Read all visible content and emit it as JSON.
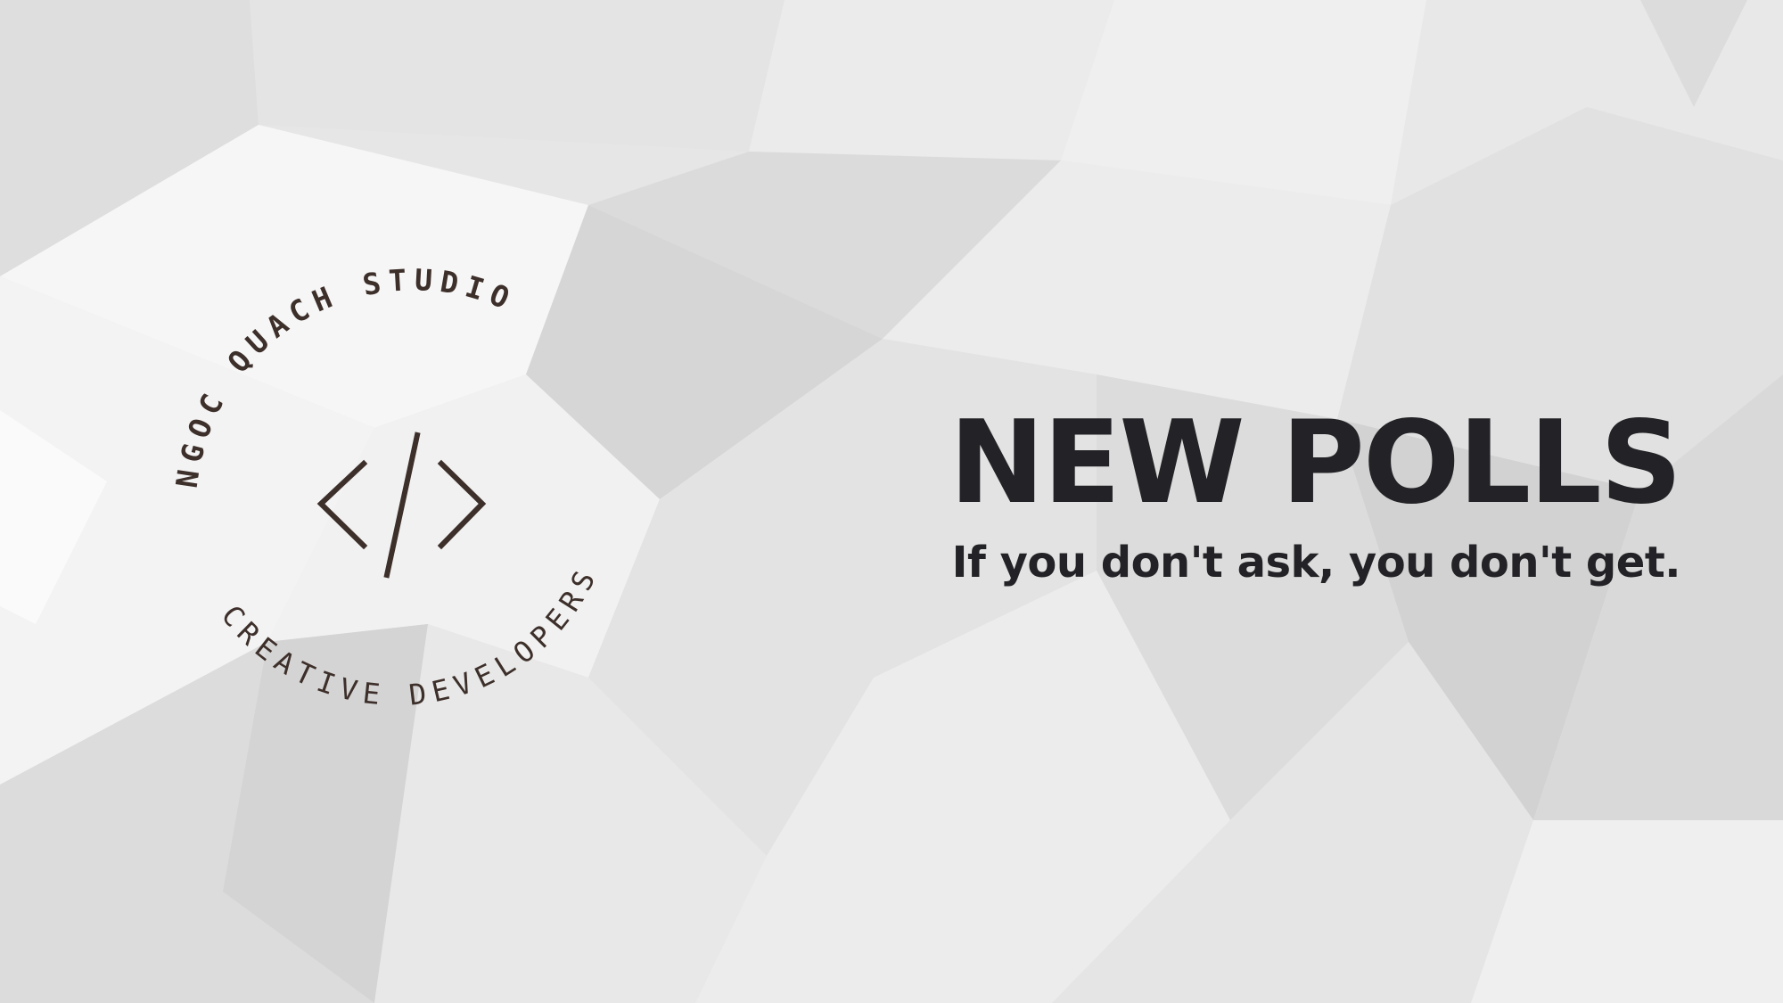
{
  "logo": {
    "top_arc_text": "NGOC QUACH STUDIO",
    "bottom_arc_text": "CREATIVE DEVELOPERS",
    "code_symbol": "</>",
    "color": "#3d2f2a"
  },
  "headline": "NEW POLLS",
  "tagline": "If you don't ask, you don't get.",
  "colors": {
    "text": "#232327",
    "background": "#e9e9e9"
  }
}
